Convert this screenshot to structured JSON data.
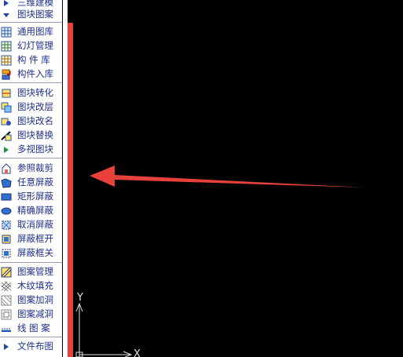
{
  "menu": {
    "top_partial": [
      {
        "label": "三维建模",
        "icon": "expand-triangle-icon"
      },
      {
        "label": "图块图案",
        "icon": "collapse-triangle-icon"
      }
    ],
    "group1": [
      {
        "label": "通用图库",
        "icon": "library-grid-icon"
      },
      {
        "label": "幻灯管理",
        "icon": "slide-grid-icon"
      },
      {
        "label": "构 件 库",
        "icon": "component-grid-icon"
      },
      {
        "label": "构件入库",
        "icon": "component-import-icon"
      }
    ],
    "group2": [
      {
        "label": "图块转化",
        "icon": "block-convert-icon"
      },
      {
        "label": "图块改层",
        "icon": "block-layer-icon"
      },
      {
        "label": "图块改名",
        "icon": "block-rename-icon"
      },
      {
        "label": "图块替换",
        "icon": "block-replace-icon"
      },
      {
        "label": "多视图块",
        "icon": "expand-triangle-icon"
      }
    ],
    "group3": [
      {
        "label": "参照裁剪",
        "icon": "xref-clip-icon"
      },
      {
        "label": "任意屏蔽",
        "icon": "freeform-mask-icon"
      },
      {
        "label": "矩形屏蔽",
        "icon": "rect-mask-icon"
      },
      {
        "label": "精确屏蔽",
        "icon": "precise-mask-icon"
      },
      {
        "label": "取消屏蔽",
        "icon": "cancel-mask-icon"
      },
      {
        "label": "屏蔽框开",
        "icon": "mask-frame-on-icon"
      },
      {
        "label": "屏蔽框关",
        "icon": "mask-frame-off-icon"
      }
    ],
    "group4": [
      {
        "label": "图案管理",
        "icon": "pattern-manage-icon"
      },
      {
        "label": "木纹填充",
        "icon": "wood-grain-icon"
      },
      {
        "label": "图案加洞",
        "icon": "pattern-add-hole-icon"
      },
      {
        "label": "图案减洞",
        "icon": "pattern-remove-hole-icon"
      },
      {
        "label": "线 图 案",
        "icon": "line-pattern-icon"
      }
    ],
    "bottom": [
      {
        "label": "文件布图",
        "icon": "expand-triangle-icon"
      }
    ]
  },
  "ucs": {
    "y_label": "Y",
    "x_label": "X"
  },
  "colors": {
    "annotation_red": "#e8413c",
    "menu_text": "#1f2f8c",
    "canvas": "#000000"
  }
}
